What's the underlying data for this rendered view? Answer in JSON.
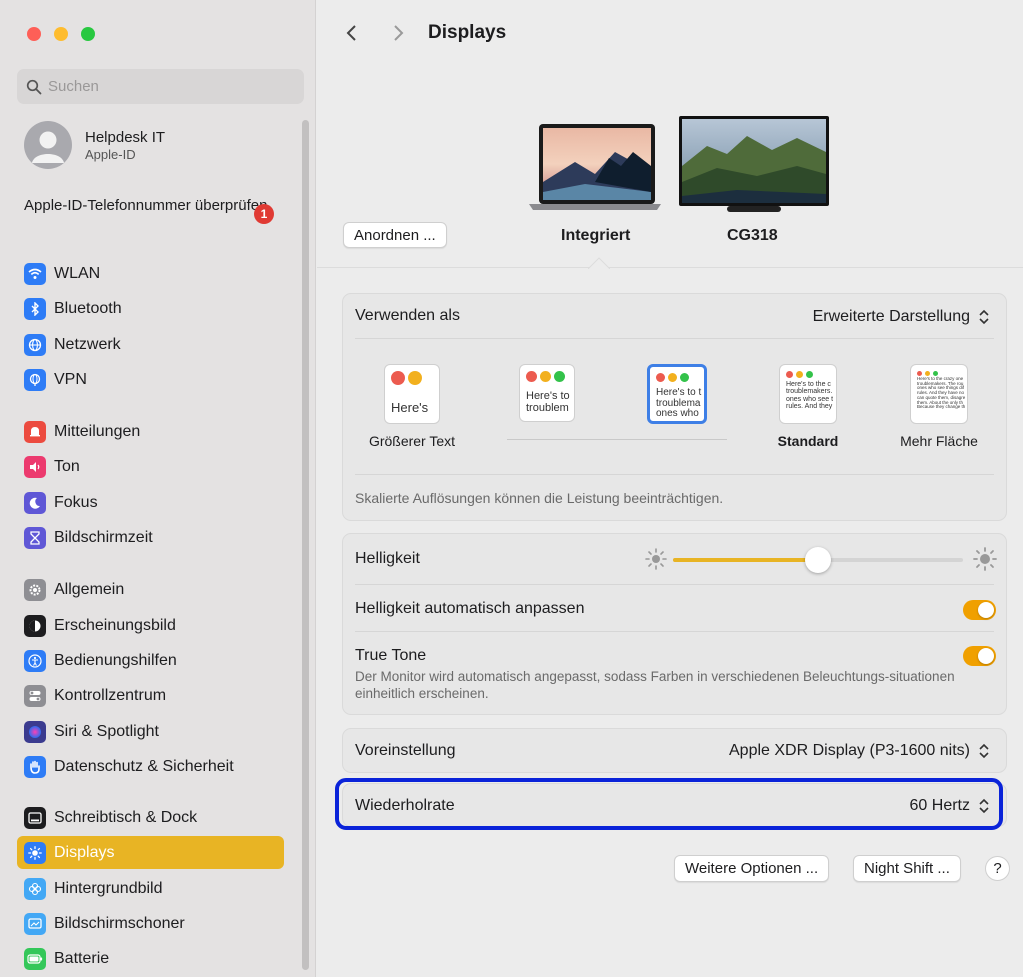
{
  "window": {
    "traffic_lights": [
      "close",
      "minimize",
      "zoom"
    ],
    "colors": {
      "close": "#fe5f57",
      "minimize": "#febc2e",
      "zoom": "#28c840"
    }
  },
  "sidebar": {
    "search_placeholder": "Suchen",
    "profile": {
      "name": "Helpdesk IT",
      "subtitle": "Apple-ID"
    },
    "notice": {
      "text": "Apple-ID-Telefonnummer überprüfen",
      "badge": "1"
    },
    "items": [
      {
        "label": "WLAN",
        "icon": "wifi-icon",
        "color": "#2e7cf6"
      },
      {
        "label": "Bluetooth",
        "icon": "bluetooth-icon",
        "color": "#2e7cf6"
      },
      {
        "label": "Netzwerk",
        "icon": "globe-icon",
        "color": "#2e7cf6"
      },
      {
        "label": "VPN",
        "icon": "vpn-globe-icon",
        "color": "#2e7cf6"
      },
      {
        "label": "Mitteilungen",
        "icon": "bell-icon",
        "color": "#ec4b3f"
      },
      {
        "label": "Ton",
        "icon": "speaker-icon",
        "color": "#ec3a6e"
      },
      {
        "label": "Fokus",
        "icon": "moon-icon",
        "color": "#5f57d6"
      },
      {
        "label": "Bildschirmzeit",
        "icon": "hourglass-icon",
        "color": "#5f57d6"
      },
      {
        "label": "Allgemein",
        "icon": "gear-icon",
        "color": "#8e8e93"
      },
      {
        "label": "Erscheinungsbild",
        "icon": "appearance-icon",
        "color": "#1d1d1f"
      },
      {
        "label": "Bedienungshilfen",
        "icon": "accessibility-icon",
        "color": "#2e7cf6"
      },
      {
        "label": "Kontrollzentrum",
        "icon": "toggles-icon",
        "color": "#8e8e93"
      },
      {
        "label": "Siri & Spotlight",
        "icon": "siri-icon",
        "color": "#3b3b8f"
      },
      {
        "label": "Datenschutz & Sicherheit",
        "icon": "hand-icon",
        "color": "#2e7cf6"
      },
      {
        "label": "Schreibtisch & Dock",
        "icon": "dock-icon",
        "color": "#1d1d1f"
      },
      {
        "label": "Displays",
        "icon": "sun-icon",
        "color": "#2e7cf6",
        "active": true
      },
      {
        "label": "Hintergrundbild",
        "icon": "flower-icon",
        "color": "#43a8f5"
      },
      {
        "label": "Bildschirmschoner",
        "icon": "screensaver-icon",
        "color": "#43a8f5"
      },
      {
        "label": "Batterie",
        "icon": "battery-icon",
        "color": "#34c759"
      }
    ]
  },
  "header": {
    "title": "Displays"
  },
  "monitors": {
    "arrange_button": "Anordnen ...",
    "displays": [
      {
        "label": "Integriert",
        "selected": true
      },
      {
        "label": "CG318",
        "selected": false
      }
    ]
  },
  "resolution": {
    "use_as_label": "Verwenden als",
    "use_as_value": "Erweiterte Darstellung",
    "options": [
      {
        "label": "Größerer Text",
        "sample": "Here's"
      },
      {
        "label": "",
        "sample": "Here's to\ntroublem"
      },
      {
        "label": "",
        "sample": "Here's to t\ntroublema\nones who",
        "selected": true
      },
      {
        "label": "Standard",
        "sample": "Here's to the c\ntroublemakers.\nones who see t\nrules. And they"
      },
      {
        "label": "Mehr Fläche",
        "sample": "Here's to the crazy one\ntroublemakers. The rou\nones who see things dif\nrules. And they have no\ncan quote them, disagre\nthem. About the only th\nBecause they change th"
      }
    ],
    "note": "Skalierte Auflösungen können die Leistung beeinträchtigen."
  },
  "brightness": {
    "label": "Helligkeit",
    "level": 0.5,
    "auto_label": "Helligkeit automatisch anpassen",
    "auto_on": true,
    "truetone_label": "True Tone",
    "truetone_desc": "Der Monitor wird automatisch angepasst, sodass Farben in verschiedenen Beleuchtungs-situationen einheitlich erscheinen.",
    "truetone_on": true,
    "accent": "#e8b424"
  },
  "preset": {
    "label": "Voreinstellung",
    "value": "Apple XDR Display (P3-1600 nits)"
  },
  "refresh": {
    "label": "Wiederholrate",
    "value": "60 Hertz"
  },
  "buttons": {
    "more_options": "Weitere Optionen ...",
    "night_shift": "Night Shift ...",
    "help": "?"
  },
  "highlight_color": "#0a23d9"
}
